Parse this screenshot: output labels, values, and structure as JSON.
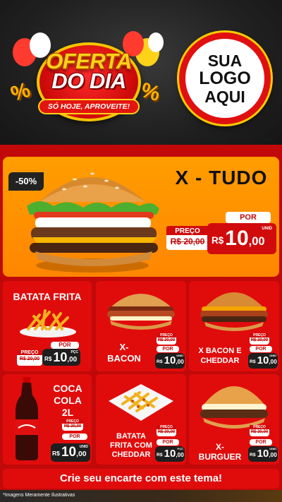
{
  "header": {
    "badge": {
      "line1": "OFERTA",
      "line2": "DO DIA",
      "ribbon": "SÓ HOJE, APROVEITE!",
      "percent": "%"
    },
    "logo": {
      "line1": "SUA",
      "line2": "LOGO",
      "line3": "AQUI"
    }
  },
  "hero": {
    "discount": "-50%",
    "name": "X - TUDO",
    "price": {
      "old_label": "PREÇO",
      "old_value": "R$ 20,00",
      "por": "POR",
      "currency": "R$",
      "whole": "10",
      "cents": ",00",
      "unit": "UNID"
    }
  },
  "products": [
    {
      "name": "BATATA FRITA",
      "old_label": "PREÇO",
      "old_value": "R$ 20,00",
      "por": "POR",
      "currency": "R$",
      "whole": "10",
      "cents": ",00",
      "unit": "PÇC"
    },
    {
      "name_l1": "X-",
      "name_l2": "BACON",
      "old_label": "PREÇO",
      "old_value": "R$ 20,00",
      "por": "POR",
      "currency": "R$",
      "whole": "10",
      "cents": ",00",
      "unit": "UNID"
    },
    {
      "name_l1": "X BACON E",
      "name_l2": "CHEDDAR",
      "old_label": "PREÇO",
      "old_value": "R$ 20,00",
      "por": "POR",
      "currency": "R$",
      "whole": "10",
      "cents": ",00",
      "unit": "UNID"
    },
    {
      "name_l1": "COCA",
      "name_l2": "COLA",
      "name_l3": "2L",
      "old_label": "PREÇO",
      "old_value": "R$ 20,00",
      "por": "POR",
      "currency": "R$",
      "whole": "10",
      "cents": ",00",
      "unit": "UNID"
    },
    {
      "name_l1": "BATATA",
      "name_l2": "FRITA COM",
      "name_l3": "CHEDDAR",
      "old_label": "PREÇO",
      "old_value": "R$ 20,00",
      "por": "POR",
      "currency": "R$",
      "whole": "10",
      "cents": ",00",
      "unit": "PÇC"
    },
    {
      "name_l1": "X-",
      "name_l2": "BURGUER",
      "old_label": "PREÇO",
      "old_value": "R$ 20,00",
      "por": "POR",
      "currency": "R$",
      "whole": "10",
      "cents": ",00",
      "unit": "UNID"
    }
  ],
  "footer": {
    "cta": "Crie seu encarte com este tema!",
    "disclaimer": "*Imagens Meramente Ilustrativas"
  },
  "colors": {
    "board_red": "#c10909",
    "card_red": "#e00c0c",
    "hero_orange": "#ff9d00",
    "gold": "#ffd21a"
  }
}
